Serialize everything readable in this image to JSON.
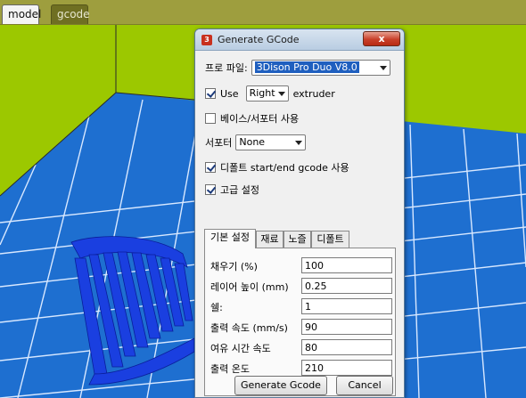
{
  "tabs": [
    {
      "label": "model",
      "active": true
    },
    {
      "label": "gcode",
      "active": false
    }
  ],
  "dialog": {
    "title": "Generate GCode",
    "close_label": "x",
    "profile_label": "프로 파일:",
    "profile_value": "3Dison Pro Duo V8.0",
    "use_label": "Use",
    "use_checked": true,
    "extruder_value": "Right",
    "extruder_label": "extruder",
    "base_support_label": "베이스/서포터 사용",
    "base_support_checked": false,
    "support_label": "서포터",
    "support_value": "None",
    "default_gcode_label": "디폴트 start/end gcode 사용",
    "default_gcode_checked": true,
    "advanced_label": "고급 설정",
    "advanced_checked": true,
    "inner_tabs": [
      "기본 설정",
      "재료",
      "노즐",
      "디폴트"
    ],
    "fields": [
      {
        "label": "채우기 (%)",
        "value": "100"
      },
      {
        "label": "레이어 높이 (mm)",
        "value": "0.25"
      },
      {
        "label": "쉘:",
        "value": "1"
      },
      {
        "label": "출력 속도 (mm/s)",
        "value": "90"
      },
      {
        "label": "여유 시간 속도",
        "value": "80"
      },
      {
        "label": "출력 온도",
        "value": "210"
      }
    ],
    "generate_label": "Generate Gcode",
    "cancel_label": "Cancel"
  },
  "colors": {
    "background_green": "#9cc800",
    "grid_blue": "#1e6fd0",
    "object_blue": "#1a3fe0"
  }
}
